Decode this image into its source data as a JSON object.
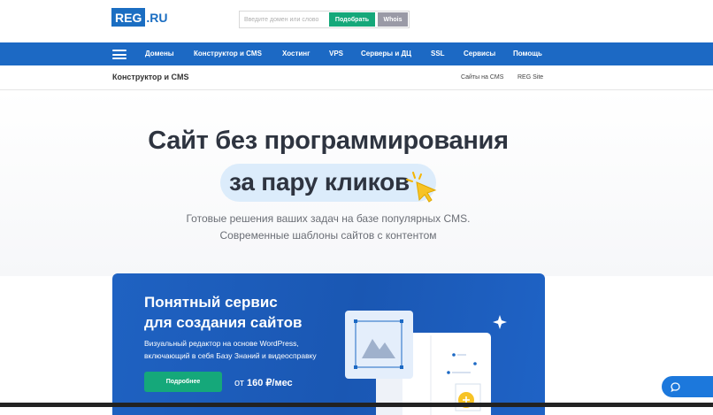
{
  "brand": {
    "logo_box": "REG",
    "logo_ru": ".RU"
  },
  "domain_search": {
    "placeholder": "Введите домен или слово",
    "pick_label": "Подобрать",
    "whois_label": "Whois"
  },
  "nav": {
    "items": [
      "Домены",
      "Конструктор и CMS",
      "Хостинг",
      "VPS",
      "Серверы и ДЦ",
      "SSL",
      "Сервисы",
      "Помощь"
    ]
  },
  "subnav": {
    "title": "Конструктор и CMS",
    "links": [
      "Сайты на CMS",
      "REG Site"
    ]
  },
  "hero": {
    "title": "Сайт без программирования",
    "highlight": "за пару кликов",
    "subtitle_line1": "Готовые решения ваших задач на базе популярных CMS.",
    "subtitle_line2": "Современные шаблоны сайтов с контентом"
  },
  "promo": {
    "title_line1": "Понятный сервис",
    "title_line2": "для создания сайтов",
    "desc_line1": "Визуальный редактор на основе WordPress,",
    "desc_line2": "включающий в себя Базу Знаний и видеосправку",
    "button_label": "Подробнее",
    "price_prefix": "от",
    "price_value": "160 ₽/мес"
  },
  "colors": {
    "brand_blue": "#1c69c4",
    "accent_green": "#15a87a",
    "whois_gray": "#9a9aa6",
    "pill_blue": "#dcecfb",
    "cursor_yellow": "#f7c325"
  },
  "icons": {
    "menu": "burger-icon",
    "cursor": "click-cursor-icon",
    "image": "image-placeholder-icon",
    "sparkle": "sparkle-icon",
    "chat": "chat-icon"
  }
}
